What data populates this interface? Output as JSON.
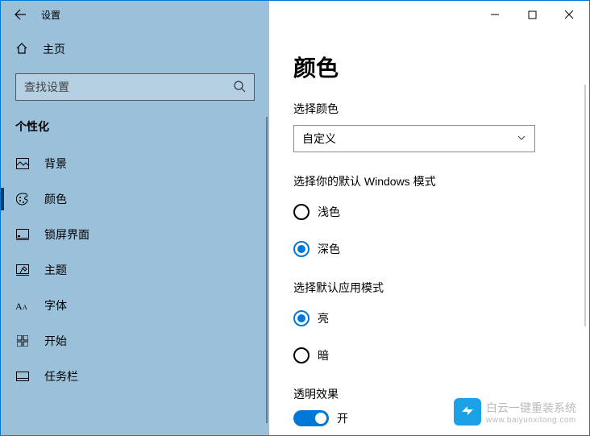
{
  "window": {
    "title": "设置"
  },
  "sidebar": {
    "home": "主页",
    "search_placeholder": "查找设置",
    "category": "个性化",
    "items": [
      {
        "label": "背景"
      },
      {
        "label": "颜色",
        "selected": true
      },
      {
        "label": "锁屏界面"
      },
      {
        "label": "主题"
      },
      {
        "label": "字体"
      },
      {
        "label": "开始"
      },
      {
        "label": "任务栏"
      }
    ]
  },
  "main": {
    "title": "颜色",
    "choose_color_label": "选择颜色",
    "choose_color_value": "自定义",
    "windows_mode_label": "选择你的默认 Windows 模式",
    "windows_mode_options": {
      "light": "浅色",
      "dark": "深色"
    },
    "windows_mode_selected": "dark",
    "app_mode_label": "选择默认应用模式",
    "app_mode_options": {
      "light": "亮",
      "dark": "暗"
    },
    "app_mode_selected": "light",
    "transparency_label": "透明效果",
    "transparency_state_text": "开",
    "transparency_on": true
  },
  "watermark": {
    "line1": "白云一键重装系统",
    "line2": "www.baiyunxitong.com"
  }
}
